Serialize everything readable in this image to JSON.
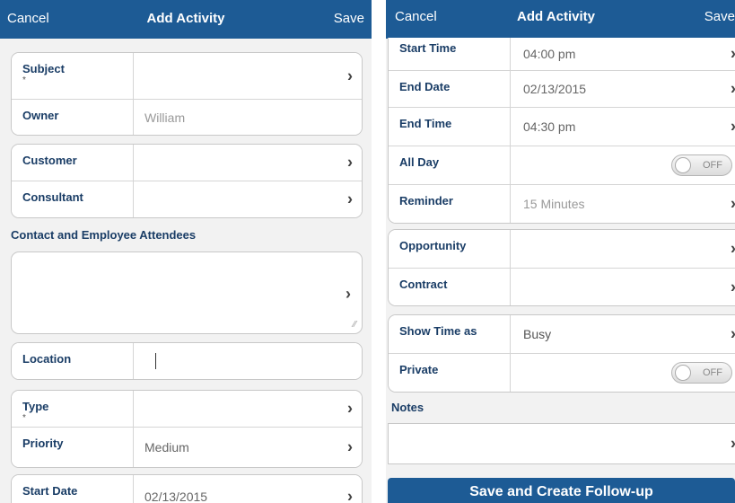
{
  "left": {
    "nav": {
      "cancel": "Cancel",
      "title": "Add Activity",
      "save": "Save"
    },
    "subject_label": "Subject",
    "required_mark": "*",
    "owner_label": "Owner",
    "owner_value": "William",
    "customer_label": "Customer",
    "consultant_label": "Consultant",
    "attendees_label": "Contact and Employee Attendees",
    "location_label": "Location",
    "type_label": "Type",
    "priority_label": "Priority",
    "priority_value": "Medium",
    "start_date_label": "Start Date",
    "start_date_value": "02/13/2015"
  },
  "right": {
    "nav": {
      "cancel": "Cancel",
      "title": "Add Activity",
      "save": "Save"
    },
    "start_time_label": "Start Time",
    "start_time_value": "04:00 pm",
    "end_date_label": "End Date",
    "end_date_value": "02/13/2015",
    "end_time_label": "End Time",
    "end_time_value": "04:30 pm",
    "all_day_label": "All Day",
    "all_day_toggle": "OFF",
    "reminder_label": "Reminder",
    "reminder_value": "15 Minutes",
    "opportunity_label": "Opportunity",
    "contract_label": "Contract",
    "show_time_label": "Show Time as",
    "show_time_value": "Busy",
    "private_label": "Private",
    "private_toggle": "OFF",
    "notes_label": "Notes",
    "followup_button": "Save and Create Follow-up"
  },
  "icons": {
    "chevron": "›",
    "resize": "⁄⁄"
  },
  "colors": {
    "accent": "#1d5b95",
    "label": "#1a3d66"
  }
}
